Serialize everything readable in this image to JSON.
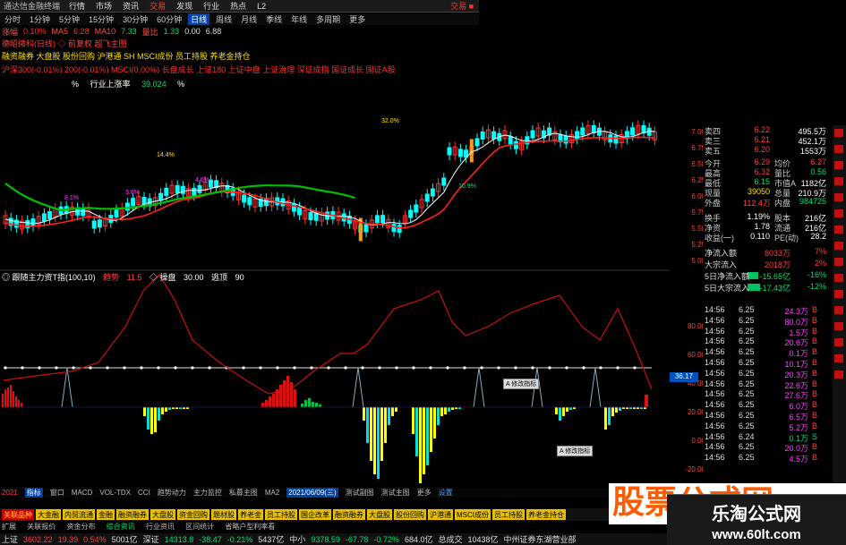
{
  "menubar": {
    "brand": "通达信金融终端",
    "items": [
      "行情",
      "市场",
      "资讯",
      "交易",
      "发现",
      "行业",
      "热点",
      "L2"
    ],
    "indicator": "●",
    "trade_button": "交易 ■"
  },
  "toolbar": {
    "items": [
      "分时",
      "1分钟",
      "5分钟",
      "15分钟",
      "30分钟",
      "60分钟",
      "日线",
      "周线",
      "月线",
      "季线",
      "年线",
      "多周期",
      "更多"
    ],
    "active": "日线"
  },
  "toolbar2": {
    "label1": "涨幅",
    "v1": "0.10%",
    "label2": "MA5",
    "v2": "6.28",
    "label3": "MA10",
    "v3": "7.33",
    "label4": "量比",
    "v4": "1.33",
    "v5": "0.00",
    "v6": "6.88"
  },
  "info": {
    "line1": "德昭微科(日线)  ◇ 前复权  超飞主图",
    "line2": "融资融券  大盘股  股份回购  沪港通  SH MSCI成份  员工持股  养老金持仓",
    "line3": "沪深300(-0.01%)  200(-0.01%)  MSCI(0.00%)  长盘成长  上证180  上证中盘  上证治理  深证成指  国证成长  国证A股",
    "pct_label": "%",
    "industry_label": "行业上涨率",
    "industry_value": "39.024",
    "pct_label2": "%"
  },
  "chart_annotations": [
    "14.4%",
    "8.1%",
    "3.6%",
    "4.6%",
    "32.0%",
    "10.9%"
  ],
  "price_axis": [
    "7.00",
    "6.75",
    "6.50",
    "6.25",
    "6.00",
    "5.75",
    "5.50",
    "5.25",
    "5.00"
  ],
  "sub_header": {
    "title": "◎ 跟随主力资T指(100,10)",
    "tag1": "趋势",
    "tag1_value": "11.5",
    "tag2": "◇ 操盘",
    "tag2_value": "30.00",
    "tag3": "逃顶",
    "tag3_value": "90"
  },
  "sub_axis": [
    "80.00",
    "60.00",
    "40.00",
    "20.00",
    "0.00",
    "-20.00"
  ],
  "axis_marker": "36.17",
  "quote_panel": {
    "rows": [
      {
        "l": "卖四",
        "v1": "6.22",
        "l2": "",
        "v2": "495.5万"
      },
      {
        "l": "卖三",
        "v1": "6.21",
        "l2": "",
        "v2": "452.1万"
      },
      {
        "l": "卖五",
        "v1": "6.20",
        "l2": "",
        "v2": "1553万"
      }
    ],
    "stats": [
      {
        "l": "今开",
        "v1": "6.29",
        "l2": "均价",
        "v2": "6.27"
      },
      {
        "l": "最高",
        "v1": "6.32",
        "l2": "量比",
        "v2": "0.56"
      },
      {
        "l": "最低",
        "v1": "6.15",
        "l2": "市值A",
        "v2": "1182亿"
      },
      {
        "l": "现量",
        "v1": "39050",
        "l2": "总量",
        "v2": "210.9万"
      },
      {
        "l": "外盘",
        "v1": "112.4万",
        "l2": "内盘",
        "v2": "984725"
      },
      {
        "l": "换手",
        "v1": "1.19%",
        "l2": "股本",
        "v2": "216亿"
      },
      {
        "l": "净资",
        "v1": "1.78",
        "l2": "流通",
        "v2": "216亿"
      },
      {
        "l": "收益(一)",
        "v1": "0.110",
        "l2": "PE(动)",
        "v2": "28.2"
      }
    ],
    "flows": [
      {
        "l": "净流入额",
        "v1": "8033万",
        "v2": "7%"
      },
      {
        "l": "大宗流入",
        "v1": "2018万",
        "v2": "2%"
      },
      {
        "l": "5日净流入额",
        "v1": "-15.65亿",
        "v2": "-16%"
      },
      {
        "l": "5日大宗流入",
        "v1": "-17.43亿",
        "v2": "-12%"
      }
    ],
    "ticks": [
      {
        "t": "14:56",
        "p": "6.25",
        "q": "24.3万",
        "s": "B"
      },
      {
        "t": "14:56",
        "p": "6.25",
        "q": "80.0万",
        "s": "B"
      },
      {
        "t": "14:56",
        "p": "6.25",
        "q": "1.5万",
        "s": "B"
      },
      {
        "t": "14:56",
        "p": "6.25",
        "q": "20.6万",
        "s": "B"
      },
      {
        "t": "14:56",
        "p": "6.25",
        "q": "0.1万",
        "s": "B"
      },
      {
        "t": "14:56",
        "p": "6.25",
        "q": "10.1万",
        "s": "B"
      },
      {
        "t": "14:56",
        "p": "6.25",
        "q": "20.3万",
        "s": "B"
      },
      {
        "t": "14:56",
        "p": "6.25",
        "q": "22.6万",
        "s": "B"
      },
      {
        "t": "14:56",
        "p": "6.25",
        "q": "27.6万",
        "s": "B"
      },
      {
        "t": "14:56",
        "p": "6.25",
        "q": "6.0万",
        "s": "B"
      },
      {
        "t": "14:56",
        "p": "6.25",
        "q": "6.5万",
        "s": "B"
      },
      {
        "t": "14:56",
        "p": "6.25",
        "q": "5.2万",
        "s": "B"
      },
      {
        "t": "14:56",
        "p": "6.24",
        "q": "0.1万",
        "s": "S"
      },
      {
        "t": "14:56",
        "p": "6.25",
        "q": "20.0万",
        "s": "B"
      },
      {
        "t": "14:56",
        "p": "6.25",
        "q": "4.5万",
        "s": "B"
      }
    ]
  },
  "bottom_tabs": {
    "year": "2021",
    "items": [
      "指标",
      "窗口",
      "MACD",
      "VOL-TDX",
      "CCI",
      "趋势动力",
      "主力监控",
      "私募主图",
      "MA2",
      "测试副图",
      "测试主图",
      "更多",
      "设置"
    ],
    "date": "2021/06/09(三)",
    "tick_marks": [
      "4",
      "6",
      "7",
      "8",
      "9"
    ]
  },
  "sector_bar": [
    "关联品种",
    "大金融",
    "内贸流通",
    "金融",
    "融资融券",
    "大盘股",
    "资金回购",
    "题材股",
    "养老金",
    "员工持股",
    "国企改革",
    "融资融券",
    "大盘股",
    "股份回购",
    "沪港通",
    "MSCI成份",
    "员工持股",
    "养老金持仓"
  ],
  "misc_bar": [
    "扩展",
    "关联报价",
    "资金分布",
    "综合资讯",
    "行业资讯",
    "区间统计",
    "省略户型利率看"
  ],
  "status_bar": {
    "sh_label": "上证",
    "sh_value": "3602.22",
    "sh_change": "19.39",
    "sh_pct": "0.54%",
    "sh_amount": "5001亿",
    "sz_label": "深证",
    "sz_value": "14313.8",
    "sz_change": "-38.47",
    "sz_pct": "-0.21%",
    "sz_amount": "5437亿",
    "zx_label": "中小",
    "zx_value": "9378.59",
    "zx_change": "-67.78",
    "zx_pct": "-0.72%",
    "zx_amount": "684.0亿",
    "total_label": "总成交",
    "total_value": "10438亿",
    "extra": "中州证券东湖营业部"
  },
  "watermark": {
    "big": "股票公式网",
    "site": "乐淘公式网",
    "url": "www.60lt.com"
  },
  "float_tags": [
    "A 修改指标",
    "A 修改指标"
  ],
  "colors": {
    "up": "#ff3030",
    "down": "#00ffff",
    "ma_short": "#ffffff",
    "ma_mid": "#ff2020",
    "ma_long": "#00c000",
    "bar_down": "#ffff00"
  }
}
